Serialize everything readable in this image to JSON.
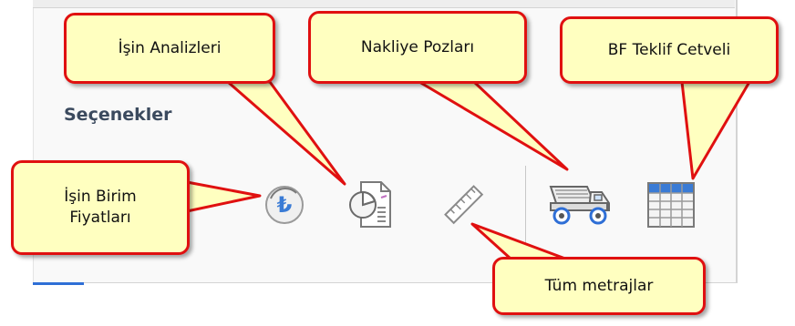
{
  "panel": {
    "title": "Seçenekler"
  },
  "icons": [
    {
      "name": "currency-icon",
      "label": "İşin Birim Fiyatları"
    },
    {
      "name": "analysis-icon",
      "label": "İşin Analizleri"
    },
    {
      "name": "ruler-icon",
      "label": "Tüm metrajlar"
    },
    {
      "name": "dump-truck-icon",
      "label": "Nakliye Pozları"
    },
    {
      "name": "table-icon",
      "label": "BF Teklif Cetveli"
    }
  ],
  "callouts": {
    "birim_fiyatlari_line1": "İşin Birim",
    "birim_fiyatlari_line2": "Fiyatları",
    "analizleri": "İşin Analizleri",
    "nakliye": "Nakliye Pozları",
    "teklif": "BF Teklif Cetveli",
    "metrajlar": "Tüm metrajlar"
  },
  "colors": {
    "callout_fill": "#ffffc0",
    "callout_border": "#e01010",
    "accent": "#2f6fd6"
  }
}
